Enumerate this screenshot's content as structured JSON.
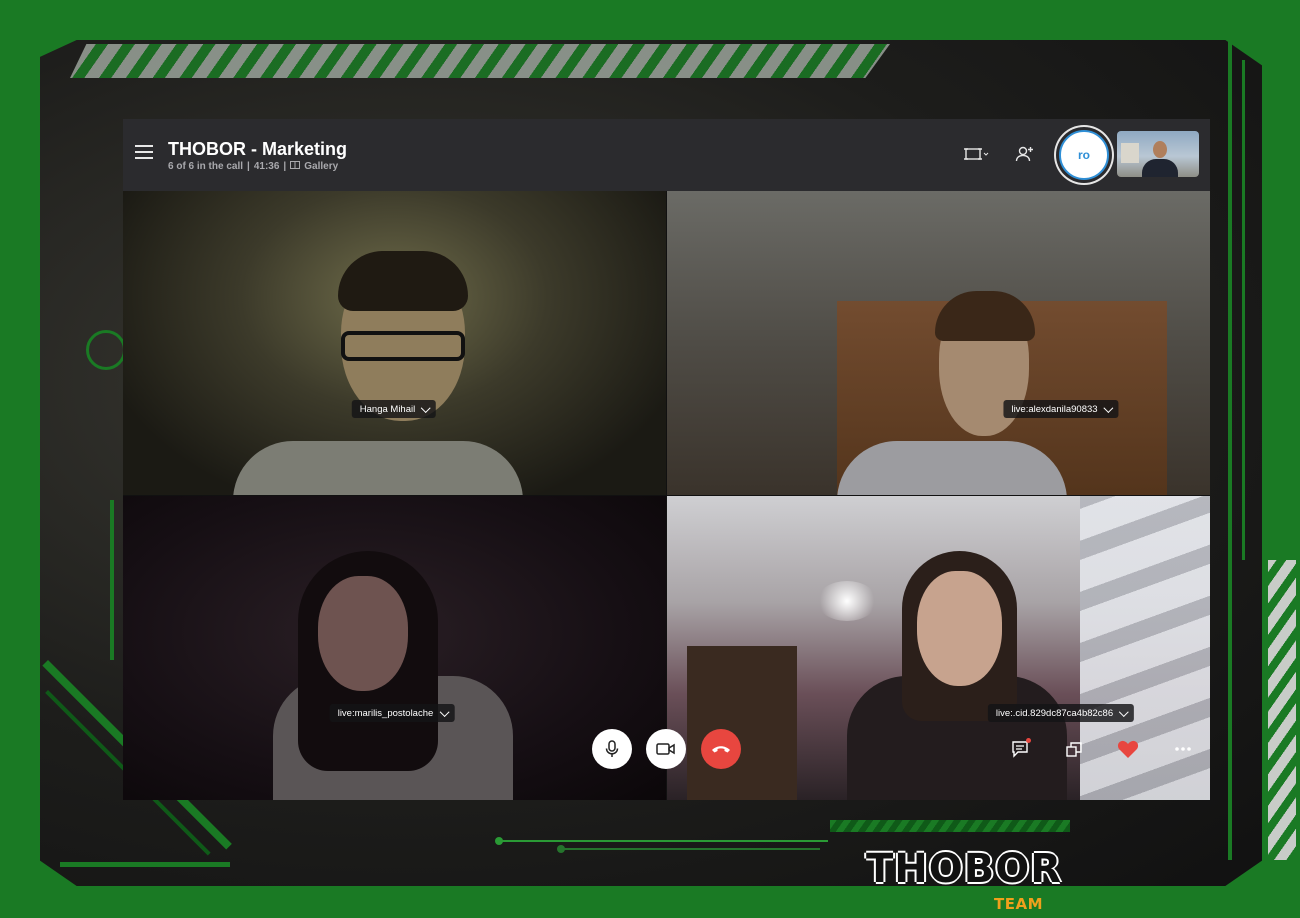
{
  "call": {
    "title": "THOBOR - Marketing",
    "participants_status": "6 of 6 in the call",
    "duration": "41:36",
    "view_mode": "Gallery",
    "separator": "|"
  },
  "self_avatar": {
    "initials": "ro"
  },
  "participants": [
    {
      "name": "Hanga Mihail"
    },
    {
      "name": "live:alexdanila90833"
    },
    {
      "name": "live:marilis_postolache"
    },
    {
      "name": "live:.cid.829dc87ca4b82c86"
    }
  ],
  "branding": {
    "logo_text": "THOBOR",
    "logo_subtext": "TEAM"
  },
  "colors": {
    "frame_green": "#1a7a24",
    "hangup_red": "#e8463f",
    "topbar": "#2b2b2e",
    "logo_orange": "#f0a01c"
  },
  "icons": {
    "menu": "hamburger-icon",
    "gallery": "gallery-icon",
    "screen_share": "screen-share-icon",
    "add_participant": "add-person-icon",
    "mic": "microphone-icon",
    "video": "video-camera-icon",
    "hangup": "phone-hangup-icon",
    "chat": "chat-icon",
    "switch_view": "switch-view-icon",
    "react": "heart-icon",
    "more": "more-options-icon"
  }
}
